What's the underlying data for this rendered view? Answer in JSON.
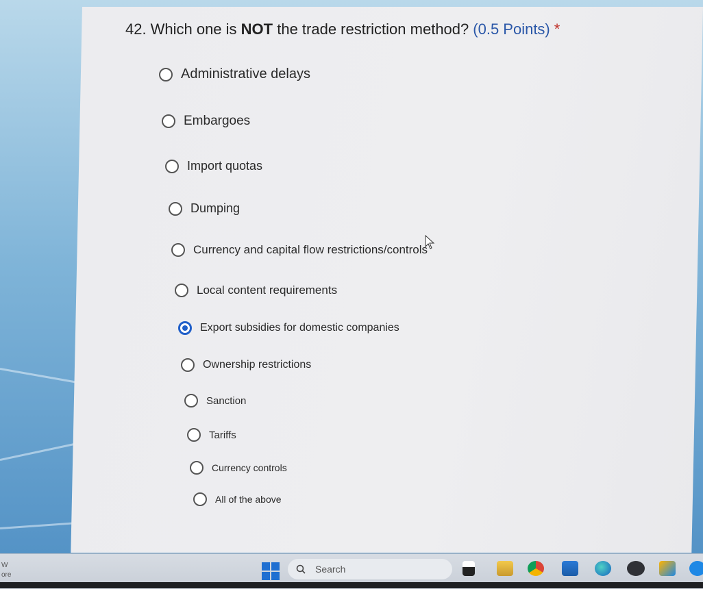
{
  "question": {
    "number": "42.",
    "text_before": "Which one is ",
    "emphasis": "NOT",
    "text_after": " the trade restriction method?",
    "points": "(0.5 Points)",
    "required_marker": "*"
  },
  "options": [
    {
      "label": "Administrative delays",
      "selected": false
    },
    {
      "label": "Embargoes",
      "selected": false
    },
    {
      "label": "Import quotas",
      "selected": false
    },
    {
      "label": "Dumping",
      "selected": false
    },
    {
      "label": "Currency and capital flow restrictions/controls",
      "selected": false
    },
    {
      "label": "Local content requirements",
      "selected": false
    },
    {
      "label": "Export subsidies for domestic companies",
      "selected": true
    },
    {
      "label": "Ownership restrictions",
      "selected": false
    },
    {
      "label": "Sanction",
      "selected": false
    },
    {
      "label": "Tariffs",
      "selected": false
    },
    {
      "label": "Currency controls",
      "selected": false
    },
    {
      "label": "All of the above",
      "selected": false
    }
  ],
  "taskbar": {
    "search_label": "Search",
    "edge_text_top": "W",
    "edge_text_bottom": "ore",
    "pinned_icons": [
      "file-explorer-icon",
      "folder-icon",
      "chrome-icon",
      "mail-icon",
      "edge-icon",
      "dell-icon",
      "app-icon",
      "app-icon-2"
    ]
  },
  "colors": {
    "accent": "#1f5fc9",
    "points": "#2a57a8",
    "required": "#c0322b"
  }
}
